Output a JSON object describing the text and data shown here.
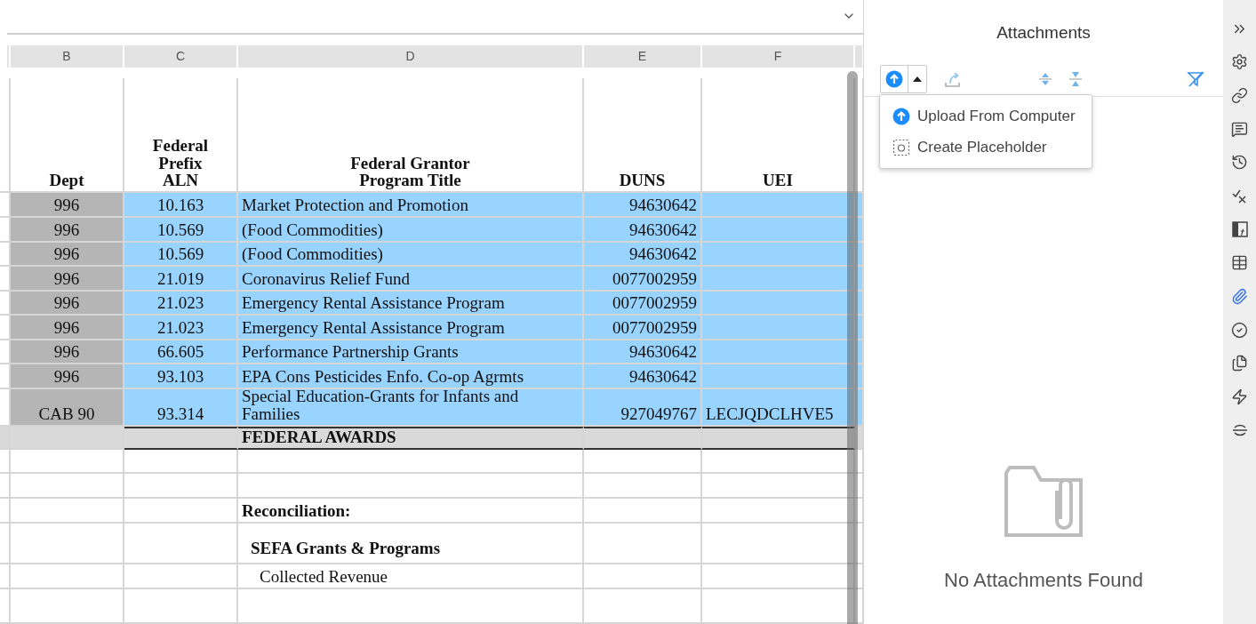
{
  "sheet": {
    "column_letters": [
      "B",
      "C",
      "D",
      "E",
      "F"
    ],
    "header": [
      "Dept",
      "Federal\nPrefix\nALN",
      "Federal Grantor\nProgram Title",
      "DUNS",
      "UEI"
    ],
    "rows": [
      {
        "selected": true,
        "cells": [
          "996",
          "10.163",
          "Market Protection and Promotion",
          "94630642",
          ""
        ]
      },
      {
        "selected": true,
        "cells": [
          "996",
          "10.569",
          "(Food Commodities)",
          "94630642",
          ""
        ]
      },
      {
        "selected": true,
        "cells": [
          "996",
          "10.569",
          "(Food Commodities)",
          "94630642",
          ""
        ]
      },
      {
        "selected": true,
        "cells": [
          "996",
          "21.019",
          "Coronavirus Relief Fund",
          "0077002959",
          ""
        ]
      },
      {
        "selected": true,
        "cells": [
          "996",
          "21.023",
          "Emergency Rental Assistance Program",
          "0077002959",
          ""
        ]
      },
      {
        "selected": true,
        "cells": [
          "996",
          "21.023",
          "Emergency Rental Assistance Program",
          "0077002959",
          ""
        ]
      },
      {
        "selected": true,
        "cells": [
          "996",
          "66.605",
          "Performance Partnership Grants",
          "94630642",
          ""
        ]
      },
      {
        "selected": true,
        "cells": [
          "996",
          "93.103",
          "EPA Cons Pesticides Enfo. Co-op Agrmts",
          "94630642",
          ""
        ]
      },
      {
        "selected": true,
        "cells": [
          "CAB 90",
          "93.314",
          "Special Education-Grants for Infants and Families",
          "927049767",
          "LECJQDCLHVE5"
        ]
      }
    ],
    "total_label": "FEDERAL AWARDS",
    "lower_rows": [
      {
        "kind": "blank"
      },
      {
        "kind": "blank"
      },
      {
        "kind": "heading",
        "text": "Reconciliation:"
      },
      {
        "kind": "subheading",
        "text": "SEFA Grants & Programs"
      },
      {
        "kind": "item",
        "text": "Collected Revenue"
      },
      {
        "kind": "blank"
      }
    ]
  },
  "panel": {
    "title": "Attachments",
    "toolbar": [
      {
        "kind": "upload"
      },
      {
        "kind": "caret"
      },
      {
        "kind": "share"
      },
      {
        "kind": "expand"
      },
      {
        "kind": "collapse"
      },
      {
        "kind": "filter-off"
      }
    ],
    "menu": [
      {
        "kind": "upload",
        "label": "Upload From Computer"
      },
      {
        "kind": "placeholder",
        "label": "Create Placeholder"
      }
    ],
    "empty_text": "No Attachments Found"
  },
  "rail": [
    {
      "kind": "collapse",
      "selected": false
    },
    {
      "kind": "settings",
      "selected": false
    },
    {
      "kind": "link",
      "selected": false
    },
    {
      "kind": "comments",
      "selected": false
    },
    {
      "kind": "history",
      "selected": false
    },
    {
      "kind": "check-x",
      "selected": false
    },
    {
      "kind": "formula",
      "selected": false
    },
    {
      "kind": "table",
      "selected": false
    },
    {
      "kind": "attachments",
      "selected": true
    },
    {
      "kind": "tasks",
      "selected": false
    },
    {
      "kind": "copies",
      "selected": false
    },
    {
      "kind": "flash",
      "selected": false
    },
    {
      "kind": "split",
      "selected": false
    }
  ]
}
